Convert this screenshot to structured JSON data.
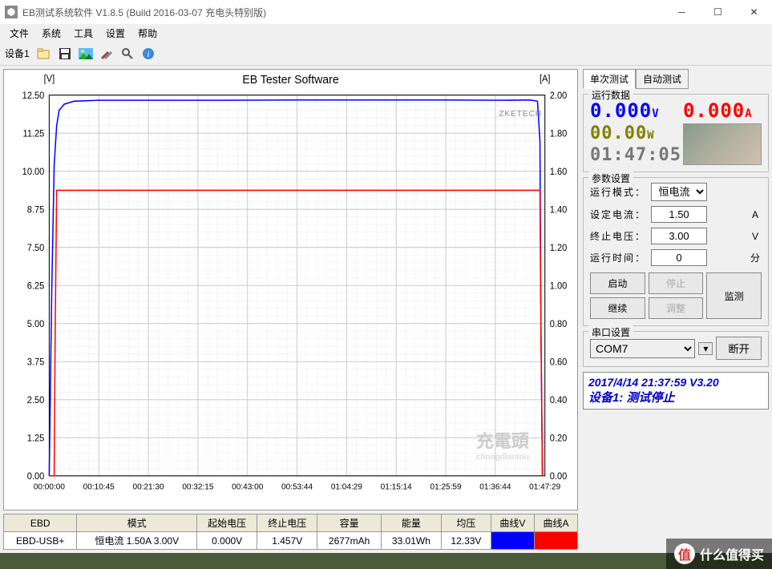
{
  "title": "EB测试系统软件 V1.8.5 (Build 2016-03-07 充电头特别版)",
  "menu": [
    "文件",
    "系统",
    "工具",
    "设置",
    "帮助"
  ],
  "toolbar_label": "设备1",
  "tabs": {
    "single": "单次测试",
    "auto": "自动测试"
  },
  "run_data": {
    "title": "运行数据",
    "volt": "0.000",
    "volt_unit": "V",
    "amp": "0.000",
    "amp_unit": "A",
    "watt": "00.00",
    "watt_unit": "W",
    "time": "01:47:05"
  },
  "params": {
    "title": "参数设置",
    "mode_label": "运行模式：",
    "mode": "恒电流",
    "current_label": "设定电流：",
    "current": "1.50",
    "current_unit": "A",
    "cutoff_label": "终止电压：",
    "cutoff": "3.00",
    "cutoff_unit": "V",
    "time_label": "运行时间：",
    "time": "0",
    "time_unit": "分"
  },
  "buttons": {
    "start": "启动",
    "stop": "停止",
    "continue": "继续",
    "adjust": "调整",
    "monitor": "监测"
  },
  "serial": {
    "title": "串口设置",
    "port": "COM7",
    "disconnect": "断开"
  },
  "status": {
    "timestamp": "2017/4/14 21:37:59  V3.20",
    "device": "设备1: 测试停止"
  },
  "table": {
    "headers": [
      "EBD",
      "模式",
      "起始电压",
      "终止电压",
      "容量",
      "能量",
      "均压",
      "曲线V",
      "曲线A"
    ],
    "row": [
      "EBD-USB+",
      "恒电流 1.50A 3.00V",
      "0.000V",
      "1.457V",
      "2677mAh",
      "33.01Wh",
      "12.33V",
      "",
      ""
    ]
  },
  "watermark": "什么值得买",
  "chart_watermark": "充電頭",
  "chart_watermark_sub": "chongdiantou",
  "chart_brand": "ZKETECH",
  "chart_data": {
    "type": "line",
    "title": "EB Tester Software",
    "left_axis_label": "[V]",
    "left_axis_range": [
      0,
      12.5
    ],
    "left_ticks": [
      0,
      1.25,
      2.5,
      3.75,
      5,
      6.25,
      7.5,
      8.75,
      10,
      11.25,
      12.5
    ],
    "right_axis_label": "[A]",
    "right_axis_range": [
      0,
      2.0
    ],
    "right_ticks": [
      0,
      0.2,
      0.4,
      0.6,
      0.8,
      1.0,
      1.2,
      1.4,
      1.6,
      1.8,
      2.0
    ],
    "x_ticks": [
      "00:00:00",
      "00:10:45",
      "00:21:30",
      "00:32:15",
      "00:43:00",
      "00:53:44",
      "01:04:29",
      "01:15:14",
      "01:25:59",
      "01:36:44",
      "01:47:29"
    ],
    "series": [
      {
        "name": "Voltage",
        "axis": "left",
        "color": "#0000ff",
        "x_frac": [
          0.0,
          0.005,
          0.01,
          0.015,
          0.02,
          0.03,
          0.05,
          0.1,
          0.2,
          0.35,
          0.5,
          0.65,
          0.8,
          0.92,
          0.97,
          0.985,
          0.99,
          0.992,
          0.995
        ],
        "y": [
          0.0,
          6.0,
          10.2,
          11.5,
          12.0,
          12.2,
          12.3,
          12.33,
          12.33,
          12.33,
          12.34,
          12.34,
          12.34,
          12.33,
          12.34,
          12.3,
          11.0,
          5.0,
          0.0
        ]
      },
      {
        "name": "Current",
        "axis": "right",
        "color": "#ff0000",
        "x_frac": [
          0.0,
          0.005,
          0.01,
          0.012,
          0.015,
          0.1,
          0.3,
          0.5,
          0.7,
          0.9,
          0.985,
          0.99,
          0.992,
          0.995
        ],
        "y": [
          0.0,
          0.0,
          0.0,
          0.75,
          1.5,
          1.5,
          1.5,
          1.5,
          1.5,
          1.5,
          1.5,
          1.5,
          0.75,
          0.0
        ]
      }
    ]
  }
}
